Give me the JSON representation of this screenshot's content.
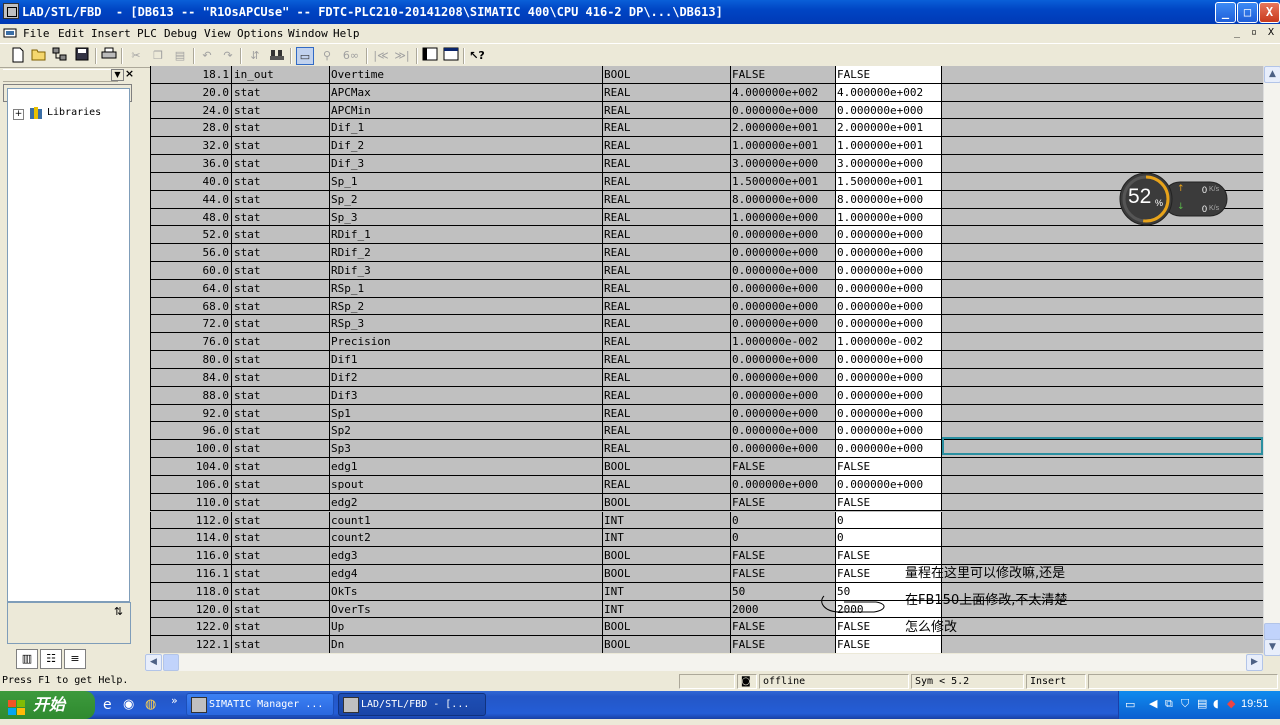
{
  "window": {
    "title": "LAD/STL/FBD  - [DB613 -- \"R1OsAPCUse\" -- FDTC-PLC210-20141208\\SIMATIC 400\\CPU 416-2 DP\\...\\DB613]",
    "min": "_",
    "max": "□",
    "close": "X"
  },
  "menu": {
    "items": [
      "File",
      "Edit",
      "Insert",
      "PLC",
      "Debug",
      "View",
      "Options",
      "Window",
      "Help"
    ],
    "mdi_min": "_",
    "mdi_restore": "▫",
    "mdi_close": "X"
  },
  "toolbar": {
    "icons": [
      "new-icon",
      "open-icon",
      "accessible-nodes-icon",
      "save-icon",
      "print-icon",
      "cut-icon",
      "copy-icon",
      "paste-icon",
      "undo-icon",
      "redo-icon",
      "load-icon",
      "monitor-icon",
      "overview-icon",
      "go-online-icon",
      "prev-icon",
      "next-icon",
      "window-icon",
      "details-icon",
      "help-icon"
    ]
  },
  "left_pane": {
    "tree_root": "Libraries",
    "expand": "+",
    "sort_button": "⇅"
  },
  "table": {
    "rows": [
      {
        "addr": "18.1",
        "decl": "in_out",
        "name": "Overtime",
        "type": "BOOL",
        "init": "FALSE",
        "actual": "FALSE"
      },
      {
        "addr": "20.0",
        "decl": "stat",
        "name": "APCMax",
        "type": "REAL",
        "init": "4.000000e+002",
        "actual": "4.000000e+002"
      },
      {
        "addr": "24.0",
        "decl": "stat",
        "name": "APCMin",
        "type": "REAL",
        "init": "0.000000e+000",
        "actual": "0.000000e+000"
      },
      {
        "addr": "28.0",
        "decl": "stat",
        "name": "Dif_1",
        "type": "REAL",
        "init": "2.000000e+001",
        "actual": "2.000000e+001"
      },
      {
        "addr": "32.0",
        "decl": "stat",
        "name": "Dif_2",
        "type": "REAL",
        "init": "1.000000e+001",
        "actual": "1.000000e+001"
      },
      {
        "addr": "36.0",
        "decl": "stat",
        "name": "Dif_3",
        "type": "REAL",
        "init": "3.000000e+000",
        "actual": "3.000000e+000"
      },
      {
        "addr": "40.0",
        "decl": "stat",
        "name": "Sp_1",
        "type": "REAL",
        "init": "1.500000e+001",
        "actual": "1.500000e+001"
      },
      {
        "addr": "44.0",
        "decl": "stat",
        "name": "Sp_2",
        "type": "REAL",
        "init": "8.000000e+000",
        "actual": "8.000000e+000"
      },
      {
        "addr": "48.0",
        "decl": "stat",
        "name": "Sp_3",
        "type": "REAL",
        "init": "1.000000e+000",
        "actual": "1.000000e+000"
      },
      {
        "addr": "52.0",
        "decl": "stat",
        "name": "RDif_1",
        "type": "REAL",
        "init": "0.000000e+000",
        "actual": "0.000000e+000"
      },
      {
        "addr": "56.0",
        "decl": "stat",
        "name": "RDif_2",
        "type": "REAL",
        "init": "0.000000e+000",
        "actual": "0.000000e+000"
      },
      {
        "addr": "60.0",
        "decl": "stat",
        "name": "RDif_3",
        "type": "REAL",
        "init": "0.000000e+000",
        "actual": "0.000000e+000"
      },
      {
        "addr": "64.0",
        "decl": "stat",
        "name": "RSp_1",
        "type": "REAL",
        "init": "0.000000e+000",
        "actual": "0.000000e+000"
      },
      {
        "addr": "68.0",
        "decl": "stat",
        "name": "RSp_2",
        "type": "REAL",
        "init": "0.000000e+000",
        "actual": "0.000000e+000"
      },
      {
        "addr": "72.0",
        "decl": "stat",
        "name": "RSp_3",
        "type": "REAL",
        "init": "0.000000e+000",
        "actual": "0.000000e+000"
      },
      {
        "addr": "76.0",
        "decl": "stat",
        "name": "Precision",
        "type": "REAL",
        "init": "1.000000e-002",
        "actual": "1.000000e-002"
      },
      {
        "addr": "80.0",
        "decl": "stat",
        "name": "Dif1",
        "type": "REAL",
        "init": "0.000000e+000",
        "actual": "0.000000e+000"
      },
      {
        "addr": "84.0",
        "decl": "stat",
        "name": "Dif2",
        "type": "REAL",
        "init": "0.000000e+000",
        "actual": "0.000000e+000"
      },
      {
        "addr": "88.0",
        "decl": "stat",
        "name": "Dif3",
        "type": "REAL",
        "init": "0.000000e+000",
        "actual": "0.000000e+000"
      },
      {
        "addr": "92.0",
        "decl": "stat",
        "name": "Sp1",
        "type": "REAL",
        "init": "0.000000e+000",
        "actual": "0.000000e+000"
      },
      {
        "addr": "96.0",
        "decl": "stat",
        "name": "Sp2",
        "type": "REAL",
        "init": "0.000000e+000",
        "actual": "0.000000e+000"
      },
      {
        "addr": "100.0",
        "decl": "stat",
        "name": "Sp3",
        "type": "REAL",
        "init": "0.000000e+000",
        "actual": "0.000000e+000"
      },
      {
        "addr": "104.0",
        "decl": "stat",
        "name": "edg1",
        "type": "BOOL",
        "init": "FALSE",
        "actual": "FALSE"
      },
      {
        "addr": "106.0",
        "decl": "stat",
        "name": "spout",
        "type": "REAL",
        "init": "0.000000e+000",
        "actual": "0.000000e+000"
      },
      {
        "addr": "110.0",
        "decl": "stat",
        "name": "edg2",
        "type": "BOOL",
        "init": "FALSE",
        "actual": "FALSE"
      },
      {
        "addr": "112.0",
        "decl": "stat",
        "name": "count1",
        "type": "INT",
        "init": "0",
        "actual": "0"
      },
      {
        "addr": "114.0",
        "decl": "stat",
        "name": "count2",
        "type": "INT",
        "init": "0",
        "actual": "0"
      },
      {
        "addr": "116.0",
        "decl": "stat",
        "name": "edg3",
        "type": "BOOL",
        "init": "FALSE",
        "actual": "FALSE"
      },
      {
        "addr": "116.1",
        "decl": "stat",
        "name": "edg4",
        "type": "BOOL",
        "init": "FALSE",
        "actual": "FALSE"
      },
      {
        "addr": "118.0",
        "decl": "stat",
        "name": "OkTs",
        "type": "INT",
        "init": "50",
        "actual": "50"
      },
      {
        "addr": "120.0",
        "decl": "stat",
        "name": "OverTs",
        "type": "INT",
        "init": "2000",
        "actual": "2000"
      },
      {
        "addr": "122.0",
        "decl": "stat",
        "name": "Up",
        "type": "BOOL",
        "init": "FALSE",
        "actual": "FALSE"
      },
      {
        "addr": "122.1",
        "decl": "stat",
        "name": "Dn",
        "type": "BOOL",
        "init": "FALSE",
        "actual": "FALSE"
      }
    ]
  },
  "annotation": {
    "line1": "量程在这里可以修改嘛,还是",
    "line2": "在FB150上面修改,不太清楚",
    "line3": "怎么修改"
  },
  "speed_widget": {
    "percent": "52",
    "percent_sign": "%",
    "up": "0",
    "down": "0",
    "unit": "K/s",
    "fraction": 0.52
  },
  "status": {
    "help": "Press F1 to get Help.",
    "mode": "offline",
    "sym": "Sym < 5.2",
    "insert": "Insert"
  },
  "taskbar": {
    "start": "开始",
    "tasks": [
      "SIMATIC Manager ...",
      "LAD/STL/FBD  - [..."
    ],
    "chevron": "»",
    "clock": "19:51"
  },
  "colors": {
    "grid_bg": "#c0c0c0",
    "actual_bg": "#ffffff",
    "selection": "#2a8fa0",
    "title_blue": "#0045c4"
  }
}
